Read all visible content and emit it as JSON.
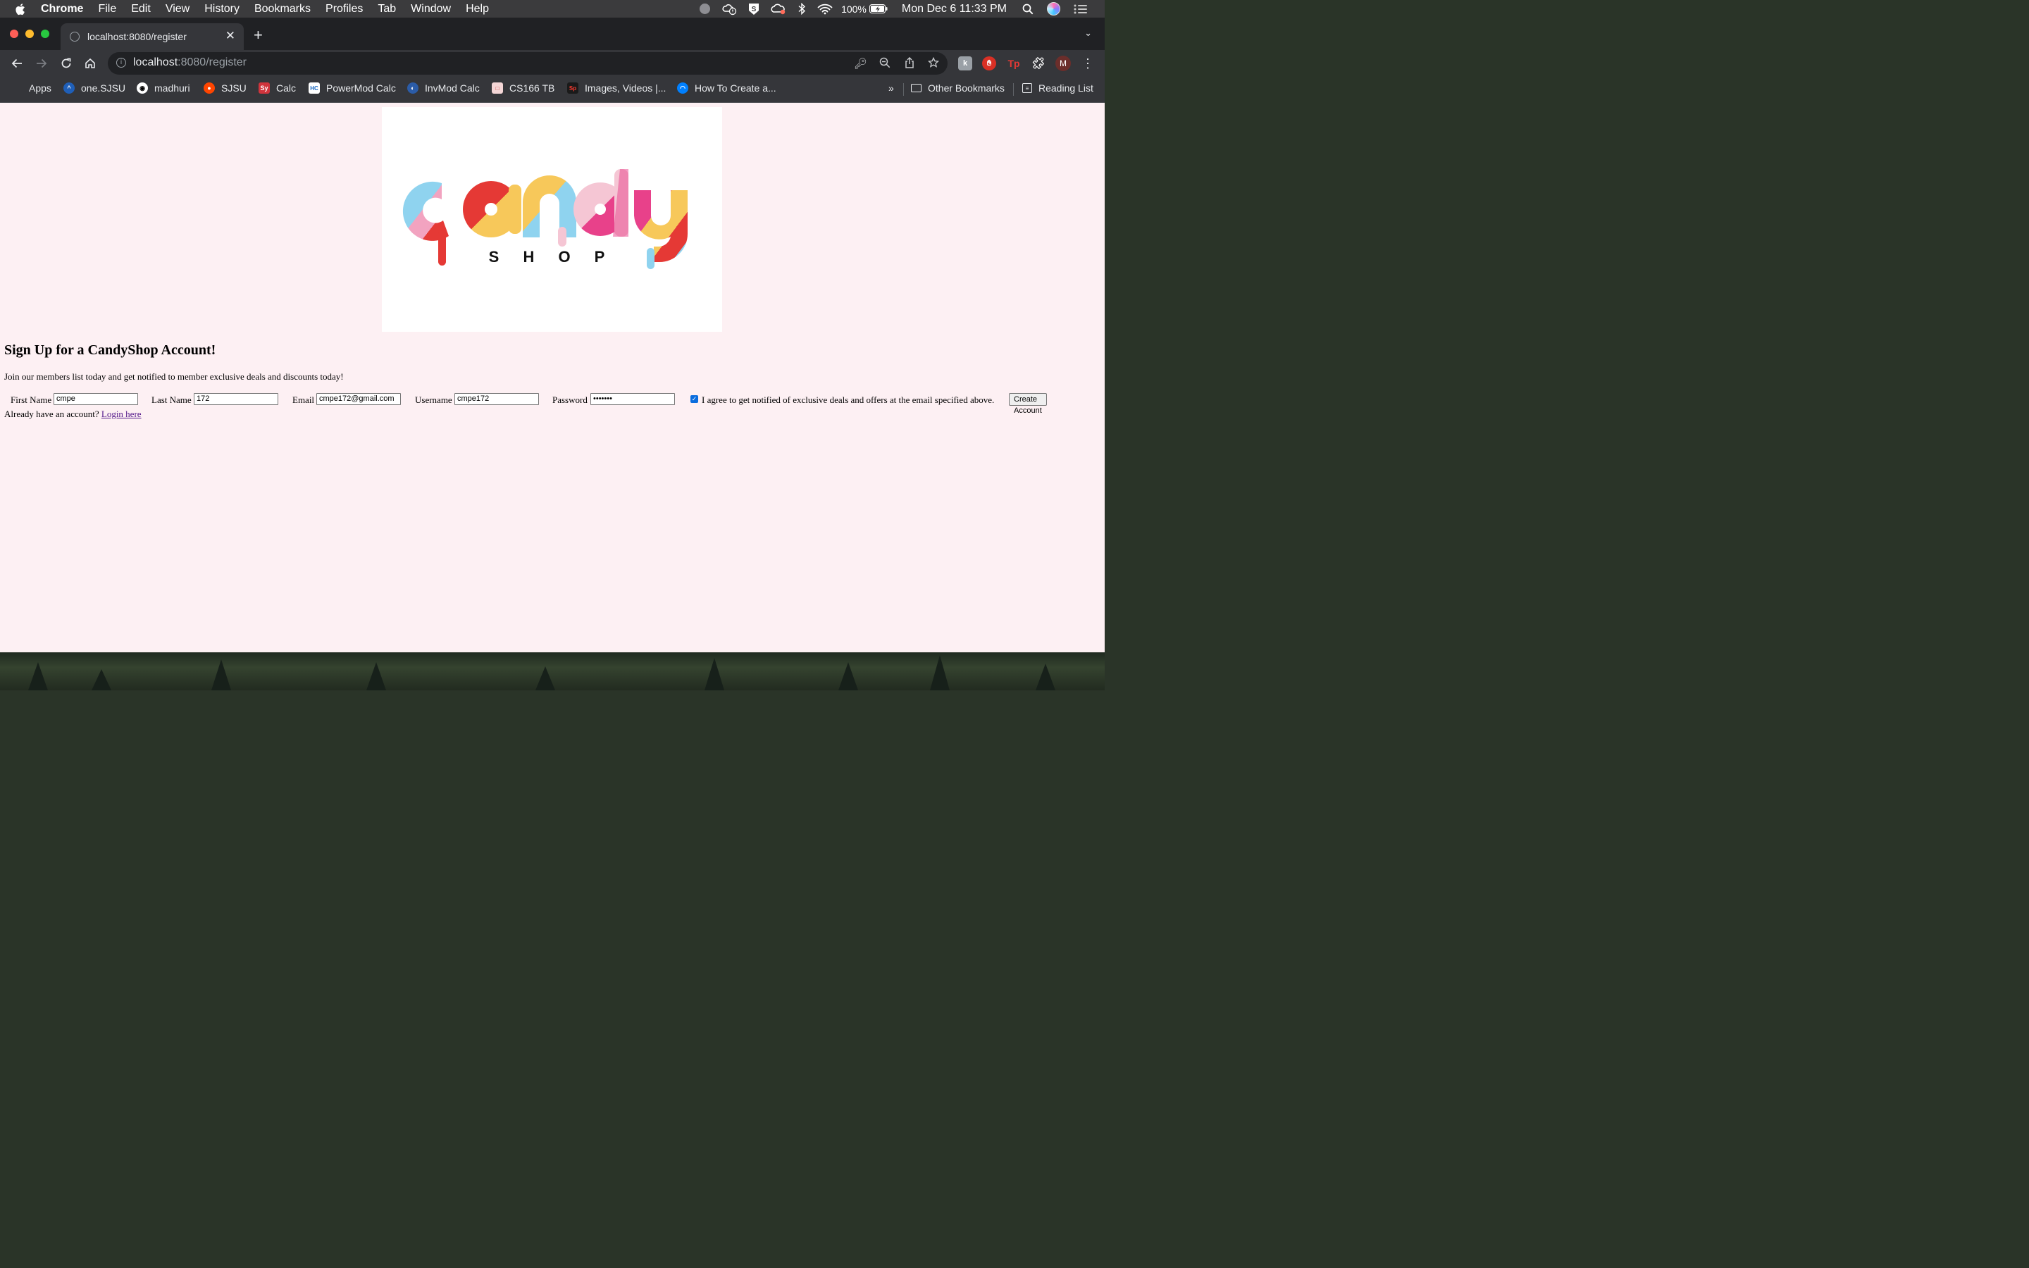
{
  "menubar": {
    "app": "Chrome",
    "items": [
      "File",
      "Edit",
      "View",
      "History",
      "Bookmarks",
      "Profiles",
      "Tab",
      "Window",
      "Help"
    ],
    "battery": "100%",
    "datetime": "Mon Dec 6  11:33 PM"
  },
  "browser": {
    "tab_title": "localhost:8080/register",
    "url_host": "localhost",
    "url_path": ":8080/register",
    "profile_initial": "M",
    "bookmarks": [
      {
        "label": "Apps",
        "icon": "apps-grid-icon"
      },
      {
        "label": "one.SJSU",
        "icon": "sjsu-icon"
      },
      {
        "label": "madhuri",
        "icon": "github-icon"
      },
      {
        "label": "SJSU",
        "icon": "reddit-icon"
      },
      {
        "label": "Calc",
        "icon": "symbolab-icon"
      },
      {
        "label": "PowerMod Calc",
        "icon": "calc-icon"
      },
      {
        "label": "InvMod Calc",
        "icon": "calc-icon"
      },
      {
        "label": "CS166 TB",
        "icon": "pdf-icon"
      },
      {
        "label": "Images, Videos |...",
        "icon": "sp-icon"
      },
      {
        "label": "How To Create a...",
        "icon": "digitalocean-icon"
      }
    ],
    "overflow": "»",
    "other_bookmarks": "Other Bookmarks",
    "reading_list": "Reading List"
  },
  "page": {
    "logo": {
      "word": "candy",
      "sub": "S H O P"
    },
    "heading": "Sign Up for a CandyShop Account!",
    "intro": "Join our members list today and get notified to member exclusive deals and discounts today!",
    "form": {
      "first_name_label": "First Name",
      "first_name_value": "cmpe",
      "last_name_label": "Last Name",
      "last_name_value": "172",
      "email_label": "Email",
      "email_value": "cmpe172@gmail.com",
      "username_label": "Username",
      "username_value": "cmpe172",
      "password_label": "Password",
      "password_value": "•••••••",
      "agree_checked": true,
      "agree_label": "I agree to get notified of exclusive deals and offers at the email specified above.",
      "submit_label": "Create Account"
    },
    "login_prompt": "Already have an account?",
    "login_link": "Login here"
  }
}
